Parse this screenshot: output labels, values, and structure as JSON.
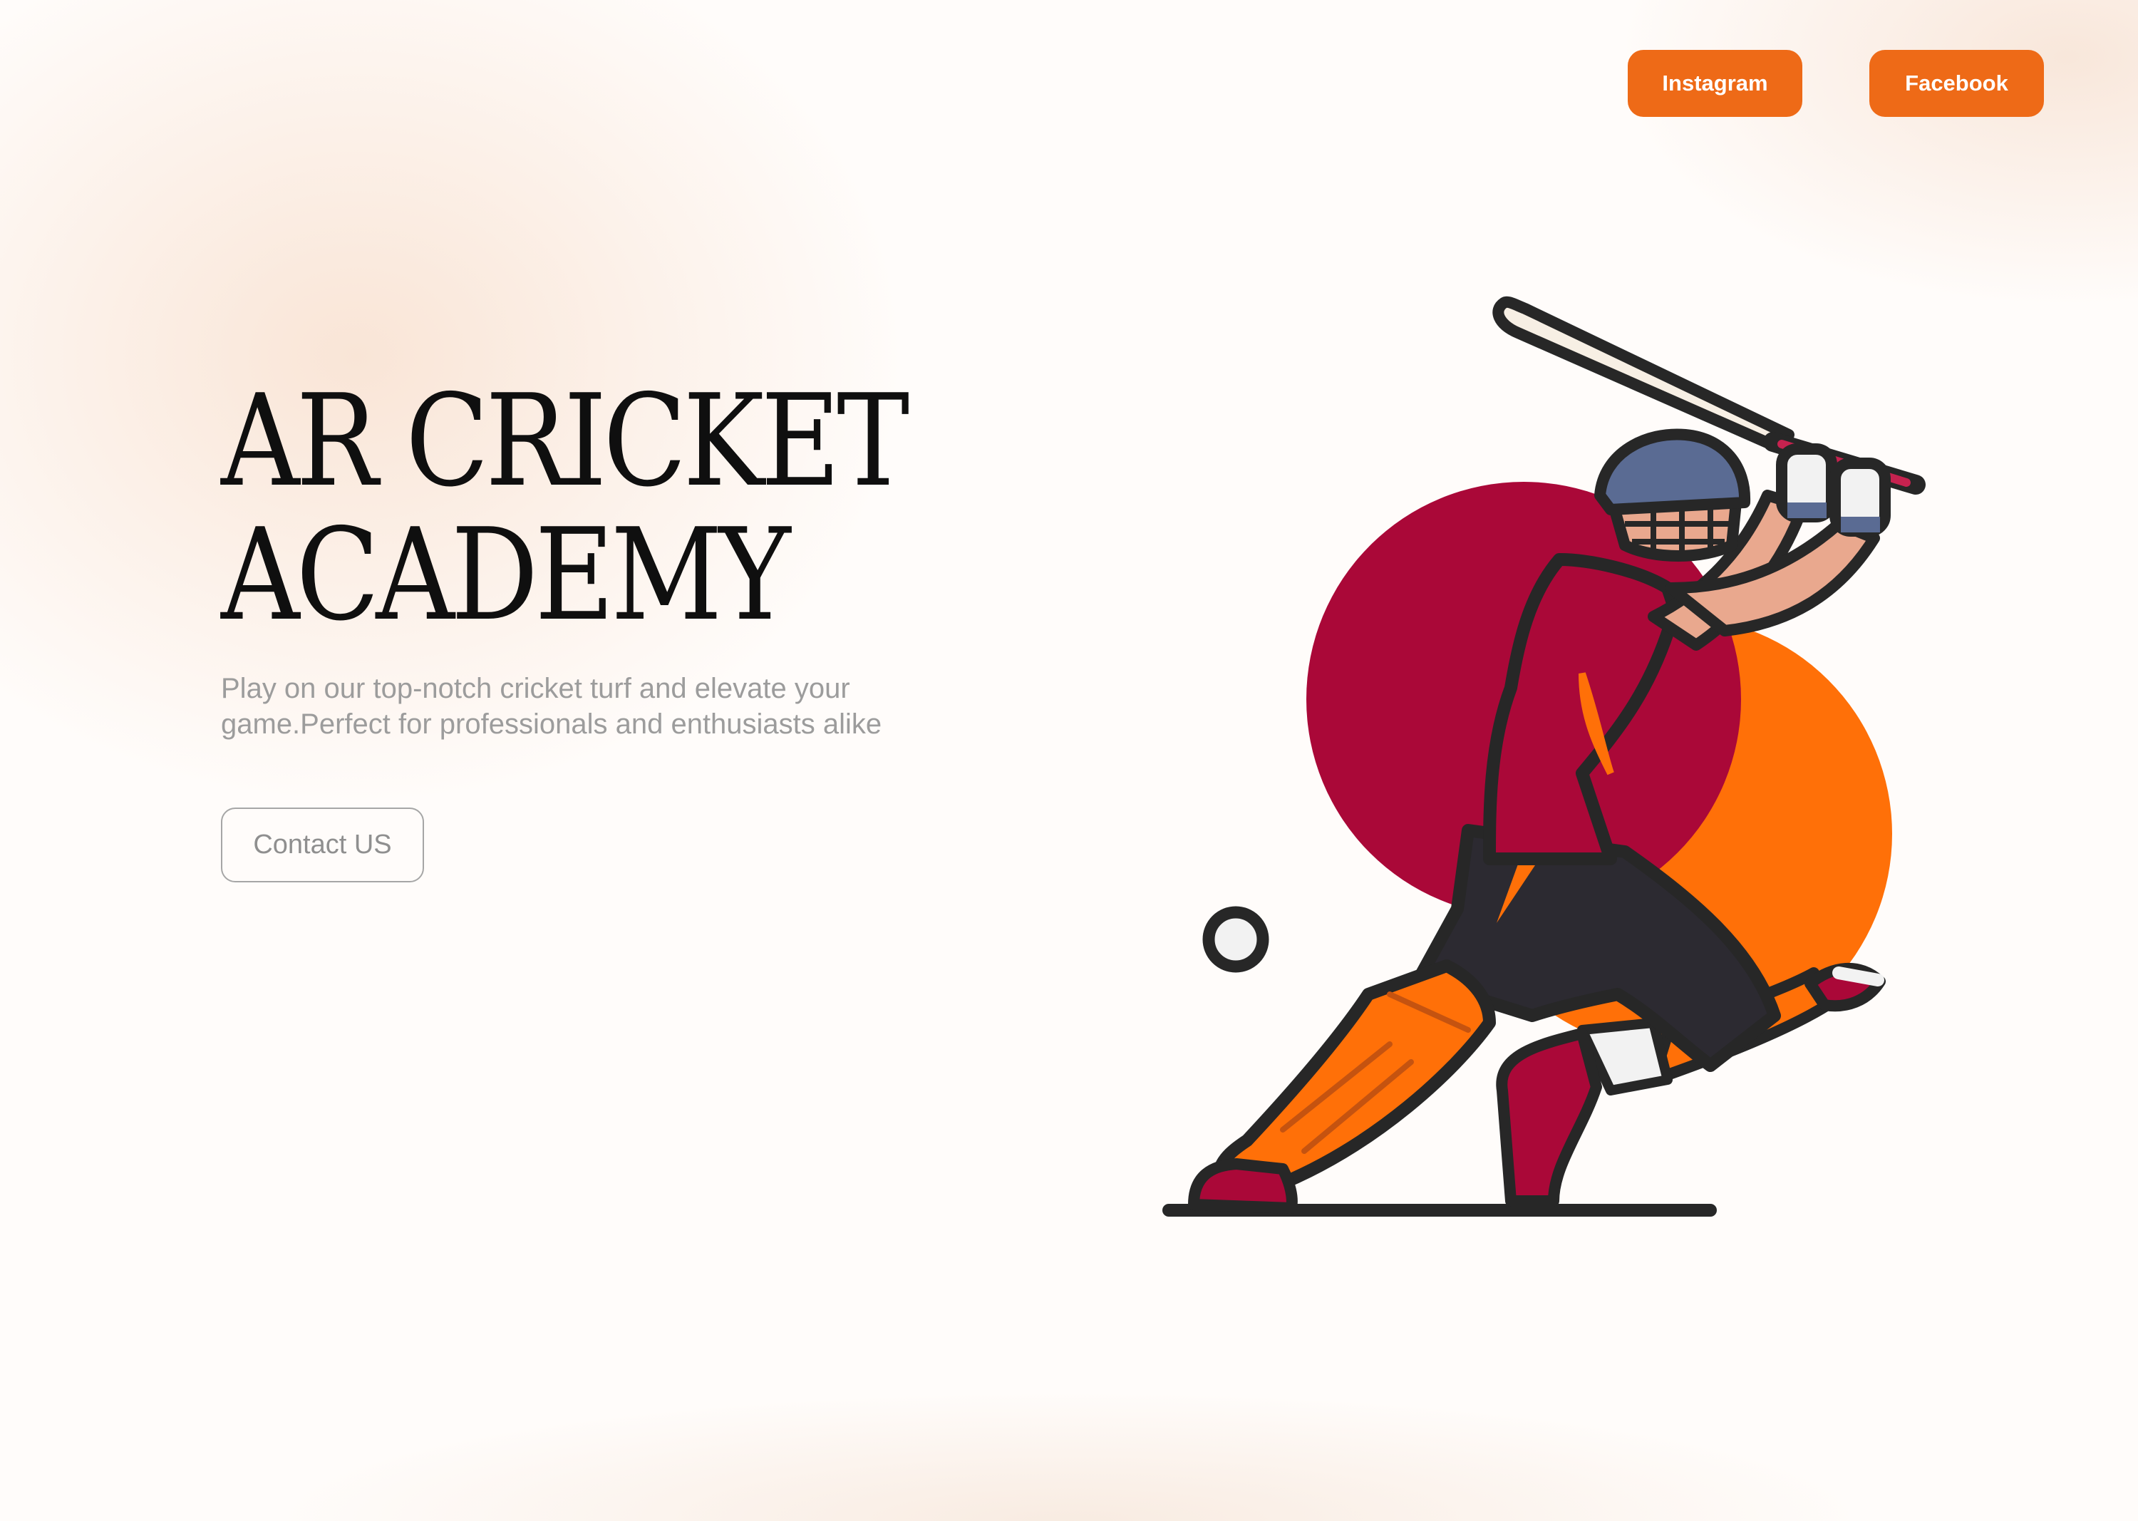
{
  "nav": {
    "instagram_label": "Instagram",
    "facebook_label": "Facebook"
  },
  "hero": {
    "title_line1": "AR CRICKET",
    "title_line2": "ACADEMY",
    "subtitle": "Play on our top-notch cricket turf and elevate your game.Perfect for professionals and enthusiasts alike",
    "contact_label": "Contact US"
  },
  "colors": {
    "accent": "#ee6a17",
    "crimson": "#aa0838",
    "orange_circle": "#ff7008",
    "outline": "#272727"
  },
  "icons": {
    "illustration": "cricket-batsman-illustration"
  }
}
